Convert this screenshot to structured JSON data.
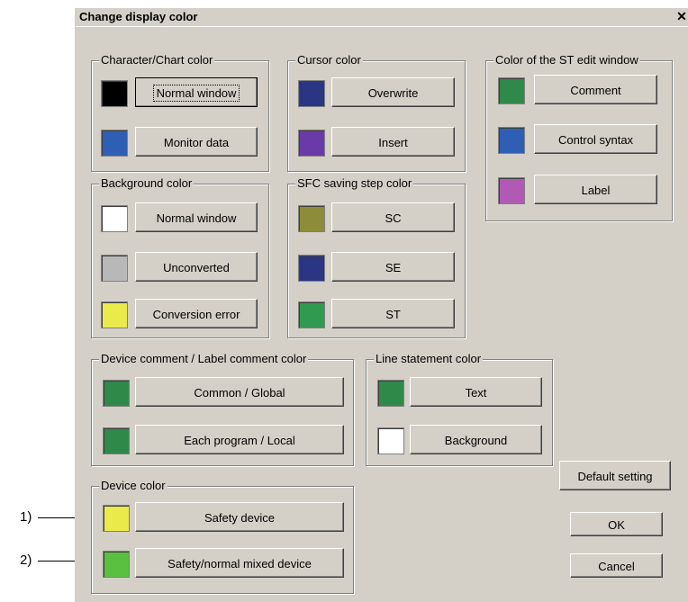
{
  "window": {
    "title": "Change display color",
    "close_glyph": "✕"
  },
  "groups": {
    "character_chart": {
      "label": "Character/Chart color",
      "items": [
        {
          "label": "Normal window",
          "color": "#000000"
        },
        {
          "label": "Monitor data",
          "color": "#2f5fb5"
        }
      ]
    },
    "cursor": {
      "label": "Cursor color",
      "items": [
        {
          "label": "Overwrite",
          "color": "#2a3584"
        },
        {
          "label": "Insert",
          "color": "#6a3aa8"
        }
      ]
    },
    "st_edit": {
      "label": "Color of the ST edit window",
      "items": [
        {
          "label": "Comment",
          "color": "#2f8a4a"
        },
        {
          "label": "Control syntax",
          "color": "#2f5fb5"
        },
        {
          "label": "Label",
          "color": "#b05ab5"
        }
      ]
    },
    "background": {
      "label": "Background color",
      "items": [
        {
          "label": "Normal window",
          "color": "#ffffff"
        },
        {
          "label": "Unconverted",
          "color": "#b8b8b8"
        },
        {
          "label": "Conversion error",
          "color": "#eaea4a"
        }
      ]
    },
    "sfc": {
      "label": "SFC saving step color",
      "items": [
        {
          "label": "SC",
          "color": "#8c8c3a"
        },
        {
          "label": "SE",
          "color": "#2a3584"
        },
        {
          "label": "ST",
          "color": "#2f9a50"
        }
      ]
    },
    "device_comment": {
      "label": "Device comment / Label comment color",
      "items": [
        {
          "label": "Common / Global",
          "color": "#2f8a4a"
        },
        {
          "label": "Each program / Local",
          "color": "#2f8a4a"
        }
      ]
    },
    "line_statement": {
      "label": "Line statement color",
      "items": [
        {
          "label": "Text",
          "color": "#2f8a4a"
        },
        {
          "label": "Background",
          "color": "#ffffff"
        }
      ]
    },
    "device": {
      "label": "Device color",
      "items": [
        {
          "label": "Safety device",
          "color": "#eaea4a"
        },
        {
          "label": "Safety/normal mixed device",
          "color": "#5ac040"
        }
      ]
    }
  },
  "actions": {
    "default": "Default setting",
    "ok": "OK",
    "cancel": "Cancel"
  },
  "callouts": {
    "one": "1)",
    "two": "2)"
  }
}
